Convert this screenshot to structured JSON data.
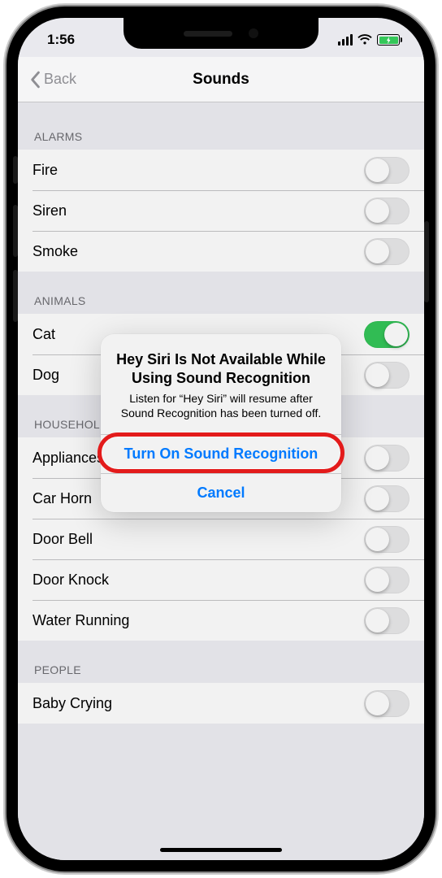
{
  "status": {
    "time": "1:56"
  },
  "nav": {
    "back": "Back",
    "title": "Sounds"
  },
  "sections": [
    {
      "header": "ALARMS",
      "items": [
        {
          "label": "Fire",
          "on": false
        },
        {
          "label": "Siren",
          "on": false
        },
        {
          "label": "Smoke",
          "on": false
        }
      ]
    },
    {
      "header": "ANIMALS",
      "items": [
        {
          "label": "Cat",
          "on": true
        },
        {
          "label": "Dog",
          "on": false
        }
      ]
    },
    {
      "header": "HOUSEHOLD",
      "items": [
        {
          "label": "Appliances",
          "on": false
        },
        {
          "label": "Car Horn",
          "on": false
        },
        {
          "label": "Door Bell",
          "on": false
        },
        {
          "label": "Door Knock",
          "on": false
        },
        {
          "label": "Water Running",
          "on": false
        }
      ]
    },
    {
      "header": "PEOPLE",
      "items": [
        {
          "label": "Baby Crying",
          "on": false
        }
      ]
    }
  ],
  "alert": {
    "title": "Hey Siri Is Not Available While Using Sound Recognition",
    "message": "Listen for “Hey Siri” will resume after Sound Recognition has been turned off.",
    "primary": "Turn On Sound Recognition",
    "cancel": "Cancel"
  },
  "colors": {
    "accent": "#007aff",
    "toggleOn": "#34c759",
    "highlight": "#e31b1b"
  }
}
